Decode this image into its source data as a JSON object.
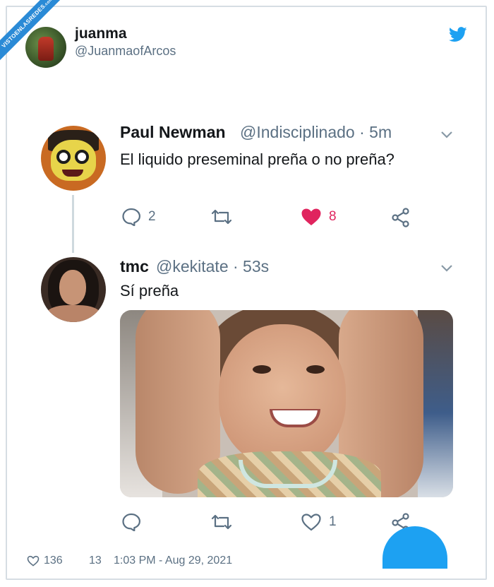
{
  "watermark": {
    "text": "VISTOENLASREDES",
    "suffix": ".com"
  },
  "author": {
    "name": "juanma",
    "handle": "@JuanmaofArcos"
  },
  "colors": {
    "twitter_blue": "#1da1f2",
    "like_red": "#e0245e",
    "muted": "#5b7083"
  },
  "tweet1": {
    "name": "Paul Newman",
    "meta": "@Indisciplinado · 5m",
    "text": "El liquido preseminal preña o no preña?",
    "replies": "2",
    "retweets": "",
    "likes": "8",
    "liked": true
  },
  "tweet2": {
    "name": "tmc",
    "meta": "@kekitate · 53s",
    "text": "Sí preña",
    "replies": "",
    "retweets": "",
    "likes": "1"
  },
  "footer": {
    "likes": "136",
    "retweets": "13",
    "timestamp": "1:03 PM - Aug 29, 2021"
  }
}
